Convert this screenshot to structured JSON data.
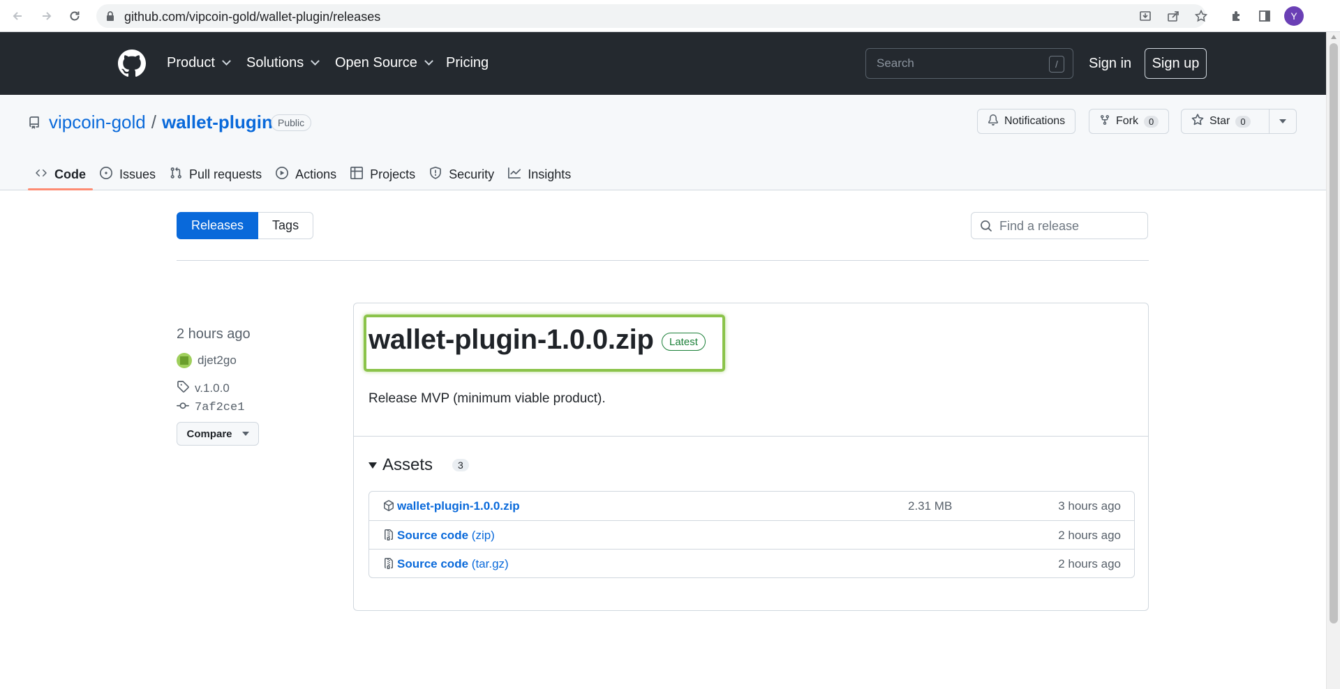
{
  "browser": {
    "url": "github.com/vipcoin-gold/wallet-plugin/releases",
    "profile_initial": "Y"
  },
  "header": {
    "nav": [
      "Product",
      "Solutions",
      "Open Source",
      "Pricing"
    ],
    "search_placeholder": "Search",
    "search_shortcut": "/",
    "sign_in": "Sign in",
    "sign_up": "Sign up"
  },
  "repo": {
    "owner": "vipcoin-gold",
    "separator": "/",
    "name": "wallet-plugin",
    "visibility": "Public",
    "notifications_label": "Notifications",
    "fork_label": "Fork",
    "fork_count": "0",
    "star_label": "Star",
    "star_count": "0",
    "tabs": [
      "Code",
      "Issues",
      "Pull requests",
      "Actions",
      "Projects",
      "Security",
      "Insights"
    ]
  },
  "releases_page": {
    "releases_tab": "Releases",
    "tags_tab": "Tags",
    "find_placeholder": "Find a release"
  },
  "release": {
    "time": "2 hours ago",
    "author": "djet2go",
    "tag": "v.1.0.0",
    "commit": "7af2ce1",
    "compare_label": "Compare",
    "title": "wallet-plugin-1.0.0.zip",
    "badge": "Latest",
    "body": "Release MVP (minimum viable product).",
    "assets_label": "Assets",
    "assets_count": "3",
    "assets": [
      {
        "name": "wallet-plugin-1.0.0.zip",
        "suffix": "",
        "size": "2.31 MB",
        "date": "3 hours ago",
        "icon": "package-icon"
      },
      {
        "name": "Source code",
        "suffix": "(zip)",
        "size": "",
        "date": "2 hours ago",
        "icon": "file-zip-icon"
      },
      {
        "name": "Source code",
        "suffix": "(tar.gz)",
        "size": "",
        "date": "2 hours ago",
        "icon": "file-zip-icon"
      }
    ]
  },
  "colors": {
    "accent": "#0969da",
    "header_bg": "#24292f",
    "latest_green": "#1a7f37",
    "highlight_green": "#8bc34a",
    "active_tab_underline": "#fd8c73"
  }
}
